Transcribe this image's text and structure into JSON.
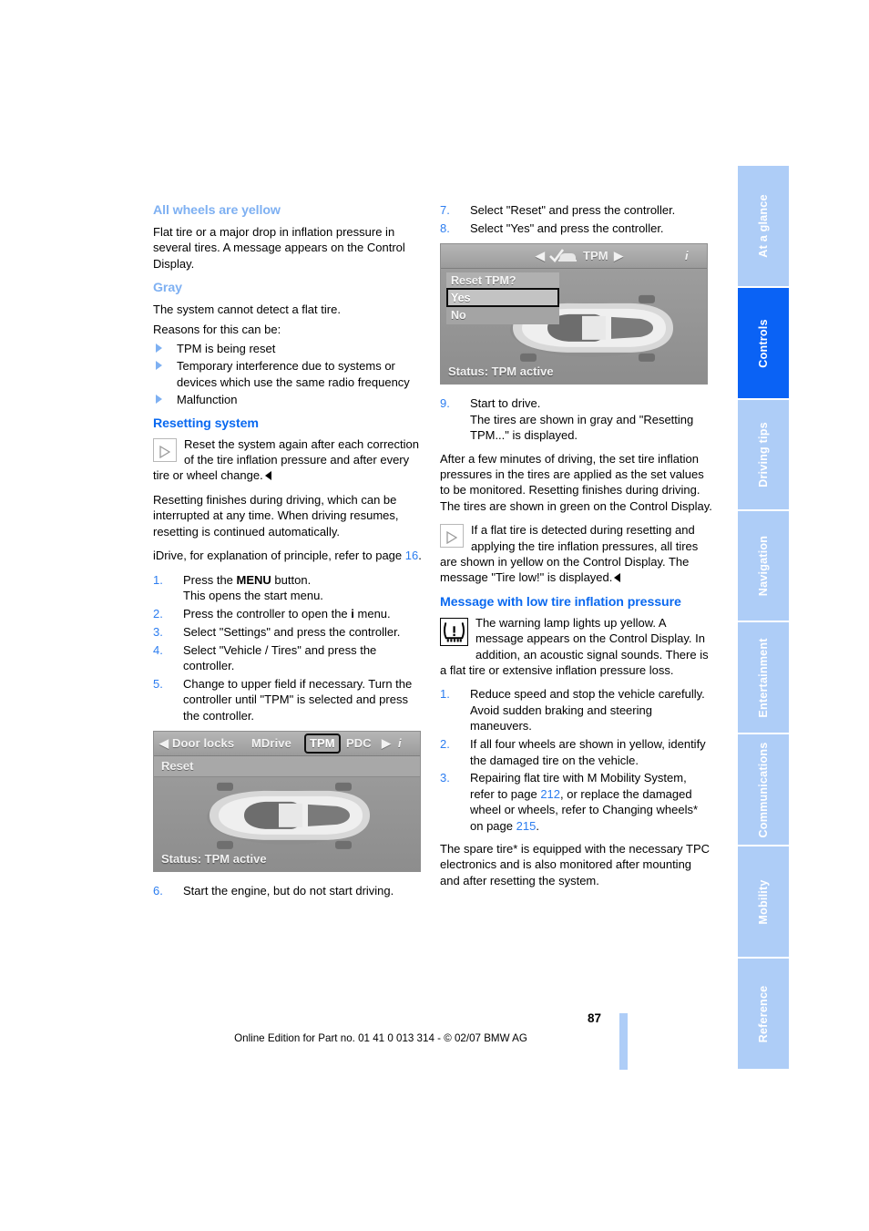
{
  "page": {
    "number": "87",
    "footer": "Online Edition for Part no. 01 41 0 013 314 - © 02/07 BMW AG"
  },
  "sidebar": {
    "tabs": [
      {
        "label": "At a glance",
        "active": false
      },
      {
        "label": "Controls",
        "active": true
      },
      {
        "label": "Driving tips",
        "active": false
      },
      {
        "label": "Navigation",
        "active": false
      },
      {
        "label": "Entertainment",
        "active": false
      },
      {
        "label": "Communications",
        "active": false
      },
      {
        "label": "Mobility",
        "active": false
      },
      {
        "label": "Reference",
        "active": false
      }
    ],
    "active_color": "#0a62f5",
    "inactive_color": "#aecdf7"
  },
  "left_column": {
    "section_all_yellow": {
      "heading": "All wheels are yellow",
      "body": "Flat tire or a major drop in inflation pressure in several tires. A message appears on the Control Display."
    },
    "section_gray": {
      "heading": "Gray",
      "body": "The system cannot detect a flat tire.",
      "reasons_intro": "Reasons for this can be:",
      "reasons": [
        "TPM is being reset",
        "Temporary interference due to systems or devices which use the same radio frequency",
        "Malfunction"
      ]
    },
    "section_resetting": {
      "heading": "Resetting system",
      "note": "Reset the system again after each correction of the tire inflation pressure and after every tire or wheel change.",
      "para1": "Resetting finishes during driving, which can be interrupted at any time. When driving resumes, resetting is continued automatically.",
      "para2_pre": "iDrive, for explanation of principle, refer to page ",
      "para2_ref": "16",
      "para2_post": ".",
      "steps": [
        {
          "num": "1.",
          "text": "Press the ",
          "bold": "MENU",
          "text2": " button.",
          "sub": "This opens the start menu."
        },
        {
          "num": "2.",
          "text": "Press the controller to open the ",
          "bold": "i",
          "text2": " menu.",
          "sub": ""
        },
        {
          "num": "3.",
          "text": "Select \"Settings\" and press the controller.",
          "bold": "",
          "text2": "",
          "sub": ""
        },
        {
          "num": "4.",
          "text": "Select \"Vehicle / Tires\" and press the controller.",
          "bold": "",
          "text2": "",
          "sub": ""
        },
        {
          "num": "5.",
          "text": "Change to upper field if necessary. Turn the controller until \"TPM\" is selected and press the controller.",
          "bold": "",
          "text2": "",
          "sub": ""
        }
      ],
      "step6": {
        "num": "6.",
        "text": "Start the engine, but do not start driving."
      }
    },
    "screenshot": {
      "menu_items": [
        "Door locks",
        "MDrive",
        "TPM",
        "PDC"
      ],
      "selected_menu": "TPM",
      "reset_label": "Reset",
      "status": "Status: TPM active",
      "left_arrow": "◀",
      "right_arrow": "▶",
      "info_icon": "i"
    }
  },
  "right_column": {
    "steps_top": [
      {
        "num": "7.",
        "text": "Select \"Reset\" and press the controller."
      },
      {
        "num": "8.",
        "text": "Select \"Yes\" and press the controller."
      }
    ],
    "screenshot": {
      "title": "TPM",
      "dialog_title": "Reset TPM?",
      "options": [
        "Yes",
        "No"
      ],
      "selected_option": "Yes",
      "status": "Status: TPM active",
      "left_arrow": "◀",
      "right_arrow": "▶"
    },
    "step9": {
      "num": "9.",
      "text": "Start to drive.",
      "sub": "The tires are shown in gray and \"Resetting TPM...\" is displayed."
    },
    "para_after": "After a few minutes of driving, the set tire inflation pressures in the tires are applied as the set values to be monitored. Resetting finishes during driving. The tires are shown in green on the Control Display.",
    "note": "If a flat tire is detected during resetting and applying the tire inflation pressures, all tires are shown in yellow on the Control Display. The message \"Tire low!\" is displayed.",
    "section_message": {
      "heading": "Message with low tire inflation pressure",
      "warn_note": "The warning lamp lights up yellow. A message appears on the Control Display. In addition, an acoustic signal sounds. There is a flat tire or extensive inflation pressure loss.",
      "steps": [
        {
          "num": "1.",
          "text": "Reduce speed and stop the vehicle carefully. Avoid sudden braking and steering maneuvers."
        },
        {
          "num": "2.",
          "text": "If all four wheels are shown in yellow, identify the damaged tire on the vehicle."
        }
      ],
      "step3": {
        "num": "3.",
        "pre": "Repairing flat tire with M Mobility System, refer to page ",
        "ref1": "212",
        "mid": ", or replace the damaged wheel or wheels, refer to Changing wheels* on page ",
        "ref2": "215",
        "post": "."
      },
      "closing": "The spare tire* is equipped with the necessary TPC electronics and is also monitored after mounting and after resetting the system."
    }
  }
}
